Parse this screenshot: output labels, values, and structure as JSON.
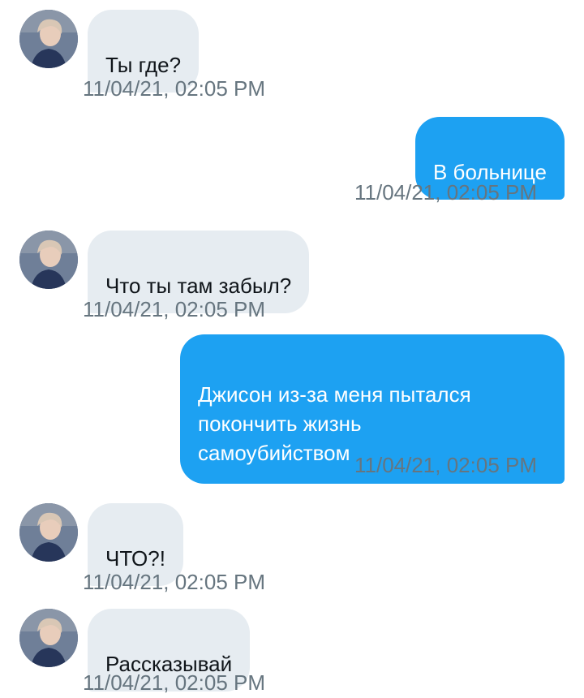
{
  "conversation": {
    "messages": [
      {
        "direction": "in",
        "text": "Ты где?",
        "timestamp": "11/04/21, 02:05 PM",
        "avatar_icon": "profile-photo"
      },
      {
        "direction": "out",
        "text": "В больнице",
        "timestamp": "11/04/21, 02:05 PM",
        "status_icon": "check-icon"
      },
      {
        "direction": "in",
        "text": "Что ты там забыл?",
        "timestamp": "11/04/21, 02:05 PM",
        "avatar_icon": "profile-photo"
      },
      {
        "direction": "out",
        "text": "Джисон из-за меня пытался\nпокончить жизнь\nсамоубийством",
        "timestamp": "11/04/21, 02:05 PM",
        "status_icon": "check-icon"
      },
      {
        "direction": "in",
        "text": "ЧТО?!",
        "timestamp": "11/04/21, 02:05 PM",
        "avatar_icon": "profile-photo"
      },
      {
        "direction": "in",
        "text": "Рассказывай",
        "timestamp": "11/04/21, 02:05 PM",
        "avatar_icon": "profile-photo"
      }
    ]
  },
  "colors": {
    "outgoing_bubble": "#1da1f2",
    "incoming_bubble": "#e6ecf1",
    "timestamp": "#66757f",
    "check": "#1da1f2"
  }
}
